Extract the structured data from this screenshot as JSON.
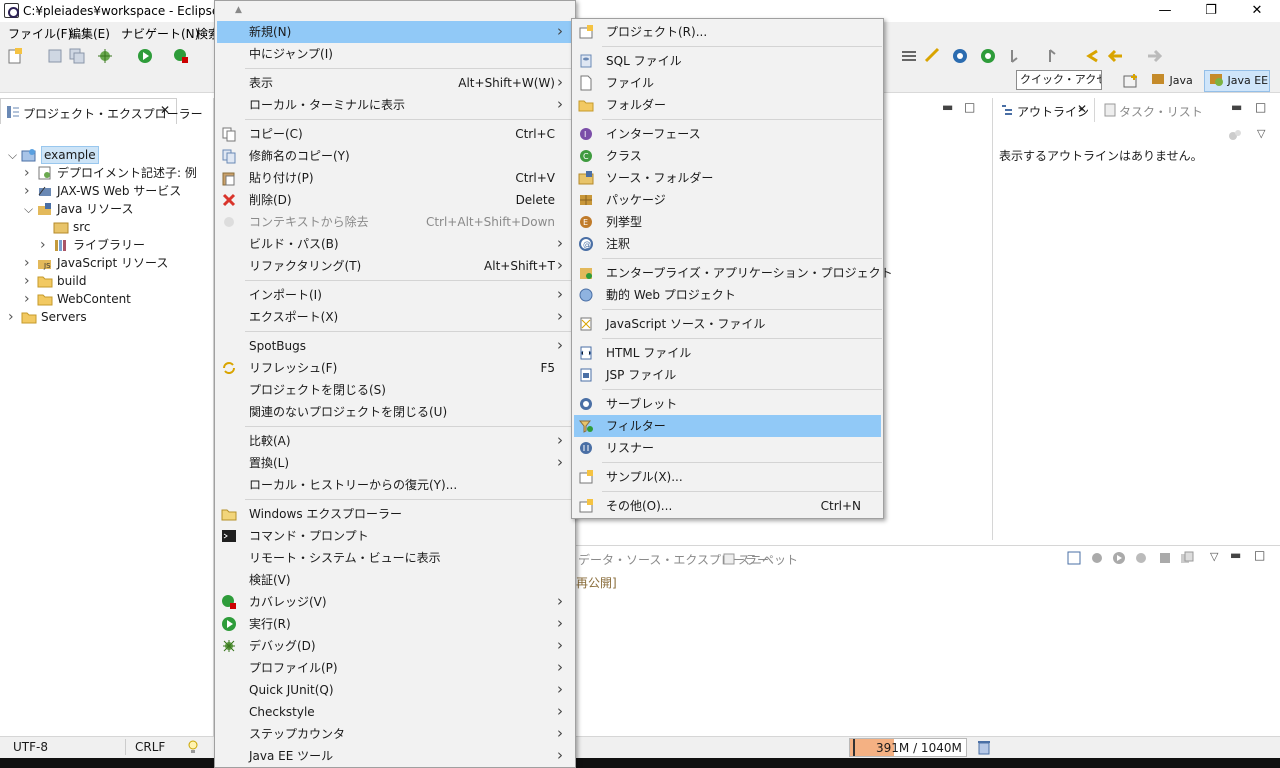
{
  "window": {
    "title": "C:¥pleiades¥workspace - Eclipse IDE",
    "minimize": "—",
    "restore": "❐",
    "close": "✕"
  },
  "menubar": [
    "ファイル(F)",
    "編集(E)",
    "ナビゲート(N)",
    "検索"
  ],
  "toolbar": {
    "quick_access": "クイック・アクセス",
    "perspective_java": "Java",
    "perspective_javaee": "Java EE"
  },
  "explorer": {
    "tab_label": "プロジェクト・エクスプローラー",
    "tree": [
      {
        "label": "example",
        "indent": 0,
        "expanded": true,
        "icon": "web-project-icon",
        "selected": true
      },
      {
        "label": "デプロイメント記述子: 例",
        "indent": 1,
        "expanded": false,
        "icon": "descriptor-icon"
      },
      {
        "label": "JAX-WS Web サービス",
        "indent": 1,
        "expanded": false,
        "icon": "webservice-icon"
      },
      {
        "label": "Java リソース",
        "indent": 1,
        "expanded": true,
        "icon": "java-resources-icon"
      },
      {
        "label": "src",
        "indent": 2,
        "expanded": null,
        "icon": "package-folder-icon"
      },
      {
        "label": "ライブラリー",
        "indent": 2,
        "expanded": false,
        "icon": "library-icon"
      },
      {
        "label": "JavaScript リソース",
        "indent": 1,
        "expanded": false,
        "icon": "js-resources-icon"
      },
      {
        "label": "build",
        "indent": 1,
        "expanded": false,
        "icon": "folder-icon"
      },
      {
        "label": "WebContent",
        "indent": 1,
        "expanded": false,
        "icon": "folder-icon"
      },
      {
        "label": "Servers",
        "indent": 0,
        "expanded": false,
        "icon": "folder-icon"
      }
    ]
  },
  "outline": {
    "tab_label": "アウトライン",
    "tab2_label": "タスク・リスト",
    "empty_message": "表示するアウトラインはありません。"
  },
  "bottom": {
    "tab_datasource": "データ・ソース・エクスプローラー",
    "tab_snippets": "スニペット",
    "content": "再公開]"
  },
  "status": {
    "encoding": "UTF-8",
    "line_ending": "CRLF",
    "heap": "391M / 1040M",
    "heap_used_fraction": 0.376
  },
  "context_menu": [
    {
      "label": "新規(N)",
      "arrow": true,
      "hl": true
    },
    {
      "label": "中にジャンプ(I)"
    },
    {
      "sep": true
    },
    {
      "label": "表示",
      "accel": "Alt+Shift+W(W)",
      "arrow": true
    },
    {
      "label": "ローカル・ターミナルに表示",
      "arrow": true
    },
    {
      "sep": true
    },
    {
      "label": "コピー(C)",
      "accel": "Ctrl+C",
      "icon": "copy-icon"
    },
    {
      "label": "修飾名のコピー(Y)",
      "icon": "copy-qualified-icon"
    },
    {
      "label": "貼り付け(P)",
      "accel": "Ctrl+V",
      "icon": "paste-icon"
    },
    {
      "label": "削除(D)",
      "accel": "Delete",
      "icon": "delete-icon"
    },
    {
      "label": "コンテキストから除去",
      "accel": "Ctrl+Alt+Shift+Down",
      "disabled": true,
      "icon": "remove-context-icon"
    },
    {
      "label": "ビルド・パス(B)",
      "arrow": true
    },
    {
      "label": "リファクタリング(T)",
      "accel": "Alt+Shift+T",
      "arrow": true
    },
    {
      "sep": true
    },
    {
      "label": "インポート(I)",
      "arrow": true
    },
    {
      "label": "エクスポート(X)",
      "arrow": true
    },
    {
      "sep": true
    },
    {
      "label": "SpotBugs",
      "arrow": true
    },
    {
      "label": "リフレッシュ(F)",
      "accel": "F5",
      "icon": "refresh-icon"
    },
    {
      "label": "プロジェクトを閉じる(S)"
    },
    {
      "label": "関連のないプロジェクトを閉じる(U)"
    },
    {
      "sep": true
    },
    {
      "label": "比較(A)",
      "arrow": true
    },
    {
      "label": "置換(L)",
      "arrow": true
    },
    {
      "label": "ローカル・ヒストリーからの復元(Y)..."
    },
    {
      "sep": true
    },
    {
      "label": "Windows エクスプローラー",
      "icon": "windows-explorer-icon"
    },
    {
      "label": "コマンド・プロンプト",
      "icon": "command-prompt-icon"
    },
    {
      "label": "リモート・システム・ビューに表示"
    },
    {
      "label": "検証(V)"
    },
    {
      "label": "カバレッジ(V)",
      "arrow": true,
      "icon": "coverage-icon"
    },
    {
      "label": "実行(R)",
      "arrow": true,
      "icon": "run-icon"
    },
    {
      "label": "デバッグ(D)",
      "arrow": true,
      "icon": "debug-icon"
    },
    {
      "label": "プロファイル(P)",
      "arrow": true
    },
    {
      "label": "Quick JUnit(Q)",
      "arrow": true
    },
    {
      "label": "Checkstyle",
      "arrow": true
    },
    {
      "label": "ステップカウンタ",
      "arrow": true
    },
    {
      "label": "Java EE ツール",
      "arrow": true
    }
  ],
  "sub_menu": [
    {
      "label": "プロジェクト(R)...",
      "icon": "project-icon"
    },
    {
      "sep": true
    },
    {
      "label": "SQL ファイル",
      "icon": "sql-file-icon"
    },
    {
      "label": "ファイル",
      "icon": "file-icon"
    },
    {
      "label": "フォルダー",
      "icon": "folder-icon"
    },
    {
      "sep": true
    },
    {
      "label": "インターフェース",
      "icon": "interface-icon"
    },
    {
      "label": "クラス",
      "icon": "class-icon"
    },
    {
      "label": "ソース・フォルダー",
      "icon": "source-folder-icon"
    },
    {
      "label": "パッケージ",
      "icon": "package-icon"
    },
    {
      "label": "列挙型",
      "icon": "enum-icon"
    },
    {
      "label": "注釈",
      "icon": "annotation-icon"
    },
    {
      "sep": true
    },
    {
      "label": "エンタープライズ・アプリケーション・プロジェクト",
      "icon": "ear-project-icon"
    },
    {
      "label": "動的 Web プロジェクト",
      "icon": "dynamic-web-project-icon"
    },
    {
      "sep": true
    },
    {
      "label": "JavaScript ソース・ファイル",
      "icon": "js-file-icon"
    },
    {
      "sep": true
    },
    {
      "label": "HTML ファイル",
      "icon": "html-file-icon"
    },
    {
      "label": "JSP ファイル",
      "icon": "jsp-file-icon"
    },
    {
      "sep": true
    },
    {
      "label": "サーブレット",
      "icon": "servlet-icon"
    },
    {
      "label": "フィルター",
      "icon": "filter-icon",
      "hl": true
    },
    {
      "label": "リスナー",
      "icon": "listener-icon"
    },
    {
      "sep": true
    },
    {
      "label": "サンプル(X)...",
      "icon": "sample-icon"
    },
    {
      "sep": true
    },
    {
      "label": "その他(O)...",
      "accel": "Ctrl+N",
      "icon": "other-icon"
    }
  ],
  "colors": {
    "highlight": "#91c9f7",
    "menu_bg": "#f2f2f2",
    "heap_bar": "#f4b183"
  }
}
